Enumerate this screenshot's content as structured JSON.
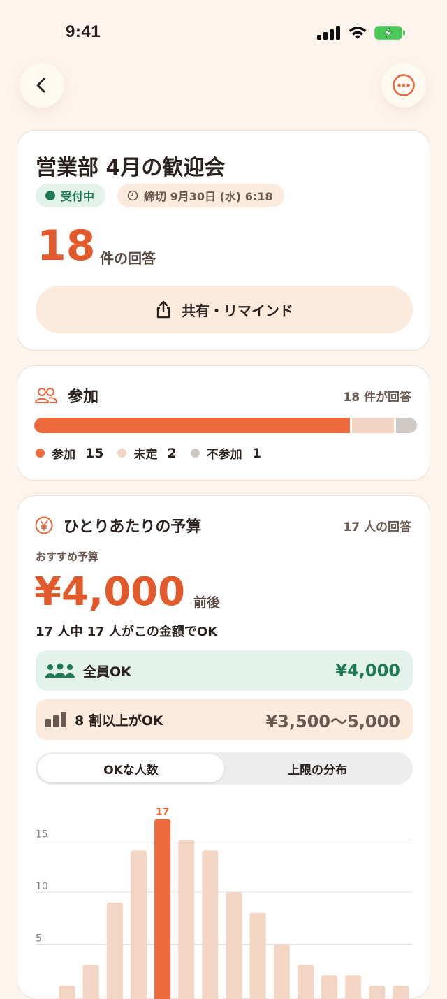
{
  "status": {
    "time": "9:41"
  },
  "event": {
    "title": "営業部 4月の歓迎会",
    "status_badge": "受付中",
    "deadline": "締切 9月30日 (水) 6:18",
    "response_count": "18",
    "response_label": "件の回答",
    "share_label": "共有・リマインド"
  },
  "attendance": {
    "title": "参加",
    "responses": "18 件が回答",
    "segments": [
      {
        "name": "参加",
        "value": 15,
        "color": "#EE6A3C"
      },
      {
        "name": "未定",
        "value": 2,
        "color": "#F3D3C2"
      },
      {
        "name": "不参加",
        "value": 1,
        "color": "#CFCAC6"
      }
    ],
    "legend": [
      {
        "label": "参加",
        "value": "15"
      },
      {
        "label": "未定",
        "value": "2"
      },
      {
        "label": "不参加",
        "value": "1"
      }
    ]
  },
  "budget": {
    "title": "ひとりあたりの予算",
    "responses": "17 人の回答",
    "recommend_label": "おすすめ予算",
    "recommend_value": "¥4,000",
    "recommend_suffix": "前後",
    "note": "17 人中 17 人がこの金額でOK",
    "all_ok_label": "全員OK",
    "all_ok_value": "¥4,000",
    "eighty_label": "8 割以上がOK",
    "eighty_value": "¥3,500〜5,000",
    "tabs": [
      "OKな人数",
      "上限の分布"
    ],
    "active_tab": 0,
    "colors": {
      "accent": "#EE6A3C",
      "bar": "#F2D5C3",
      "green": "#1F7A57"
    }
  },
  "chart_data": {
    "type": "bar",
    "yticks": [
      5,
      10,
      15
    ],
    "ylim": [
      0,
      18
    ],
    "values": [
      1,
      3,
      9,
      14,
      17,
      15,
      14,
      10,
      8,
      5,
      3,
      2,
      2,
      1,
      1
    ],
    "highlight_index": 4,
    "highlight_label": "17",
    "grid": true
  }
}
